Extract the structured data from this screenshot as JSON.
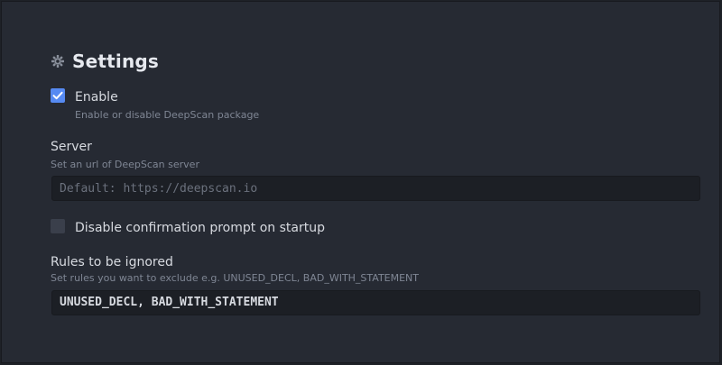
{
  "settings": {
    "title": "Settings",
    "header_icon": "gear-icon"
  },
  "enable": {
    "label": "Enable",
    "description": "Enable or disable DeepScan package",
    "checked": true
  },
  "server": {
    "label": "Server",
    "description": "Set an url of DeepScan server",
    "value": "",
    "placeholder": "Default: https://deepscan.io"
  },
  "disable_prompt": {
    "label": "Disable confirmation prompt on startup",
    "checked": false
  },
  "rules": {
    "label": "Rules to be ignored",
    "description": "Set rules you want to exclude e.g. UNUSED_DECL, BAD_WITH_STATEMENT",
    "value": "UNUSED_DECL, BAD_WITH_STATEMENT"
  },
  "colors": {
    "accent": "#568af2",
    "background": "#262a33",
    "input_background": "#1c1f25"
  }
}
